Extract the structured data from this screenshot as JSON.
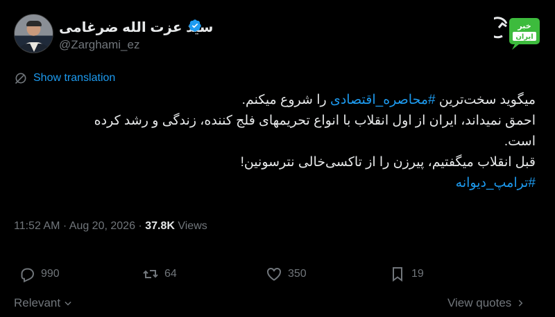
{
  "author": {
    "name": "سید عزت الله ضرغامی",
    "handle": "@Zarghami_ez",
    "verified": true
  },
  "brand_logo": {
    "text_top": "خبر",
    "text_bottom": "ایران",
    "color": "#3dbb3d"
  },
  "translate_label": "Show translation",
  "tweet": {
    "line1_start": "میگوید سخت‌ترین ",
    "line1_hashtag": "#محاصره_اقتصادی",
    "line1_end": " را شروع میکنم.",
    "line2": "احمق نمیداند، ایران از اول انقلاب با انواع تحریمهای فلج کننده، زندگی و رشد کرده",
    "line3": "است.",
    "line4": "قبل انقلاب میگفتیم، پیرزن را از تاکسی‌خالی نترسونین!",
    "line5_hashtag": "#ترامپ_دیوانه"
  },
  "meta": {
    "time": "11:52 AM",
    "separator": "·",
    "date": "Aug 20, 2026",
    "views_count": "37.8K",
    "views_label": "Views"
  },
  "actions": {
    "replies": "990",
    "reposts": "64",
    "likes": "350",
    "bookmarks": "19"
  },
  "footer": {
    "sort_label": "Relevant",
    "view_quotes_label": "View quotes"
  },
  "colors": {
    "background": "#000000",
    "text": "#e7e9ea",
    "muted": "#71767b",
    "accent": "#1d9bf0"
  }
}
